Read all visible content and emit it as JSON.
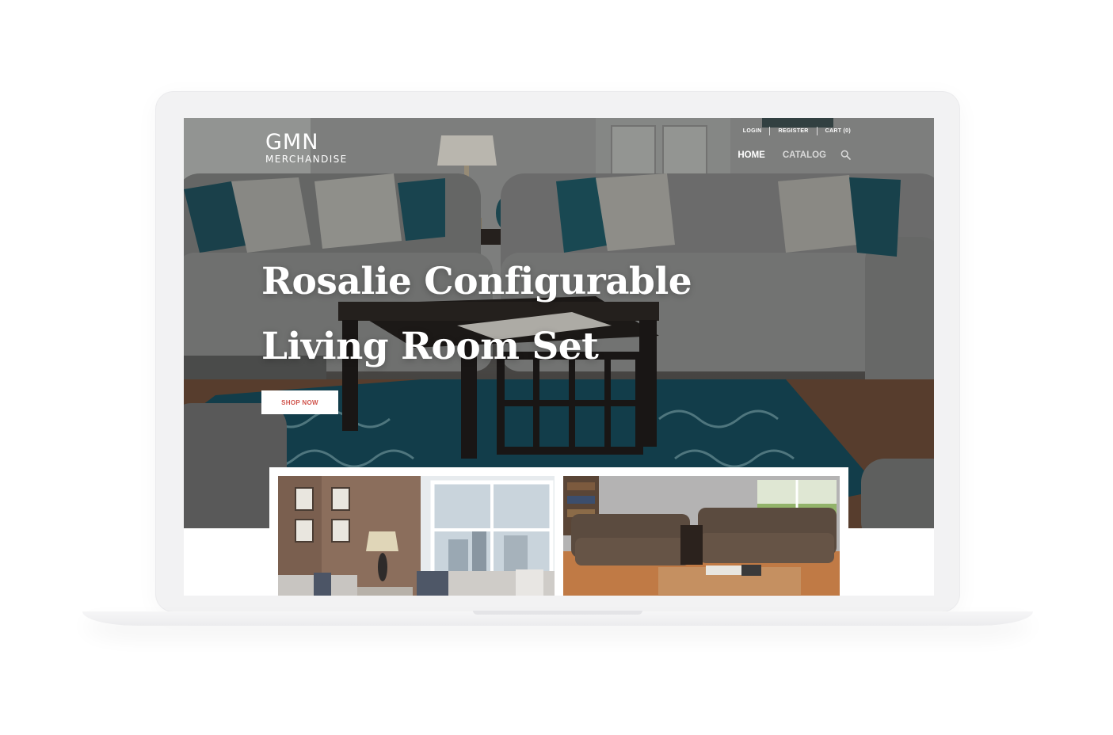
{
  "brand": {
    "name_top": "GMN",
    "name_bottom": "MERCHANDISE"
  },
  "utility_nav": {
    "login": "LOGIN",
    "register": "REGISTER",
    "cart": "CART (0)"
  },
  "main_nav": {
    "home": "HOME",
    "catalog": "CATALOG",
    "search_icon": "search-icon"
  },
  "hero": {
    "title": "Rosalie Configurable Living Room Set",
    "cta_label": "SHOP NOW"
  },
  "colors": {
    "cta_text": "#d0534b",
    "laptop_frame": "#f2f2f3"
  },
  "products": [
    {
      "image": "living-room-sectional-photo"
    },
    {
      "image": "brown-sofa-loveseat-photo"
    }
  ]
}
